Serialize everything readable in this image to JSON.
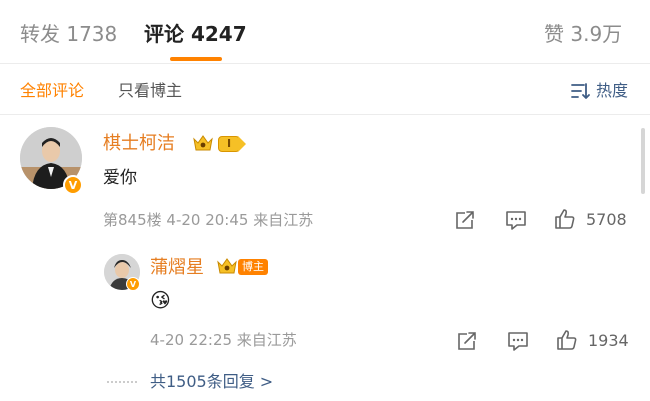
{
  "tabs": {
    "repost": {
      "label": "转发",
      "count": "1738"
    },
    "comment": {
      "label": "评论",
      "count": "4247"
    },
    "like": {
      "label": "赞",
      "count": "3.9万"
    }
  },
  "filter": {
    "all": "全部评论",
    "author_only": "只看博主",
    "sort": "热度"
  },
  "comments": [
    {
      "username": "棋士柯洁",
      "level": "I",
      "text": "爱你",
      "meta": "第845楼 4-20 20:45 来自江苏",
      "likes": "5708"
    }
  ],
  "reply": {
    "username": "蒲熠星",
    "tag": "博主",
    "text": "😘",
    "meta": "4-20 22:25 来自江苏",
    "likes": "1934"
  },
  "more_replies": "共1505条回复 >",
  "colors": {
    "accent": "#ff8200",
    "link": "#3f5d85",
    "username": "#e67e22"
  }
}
